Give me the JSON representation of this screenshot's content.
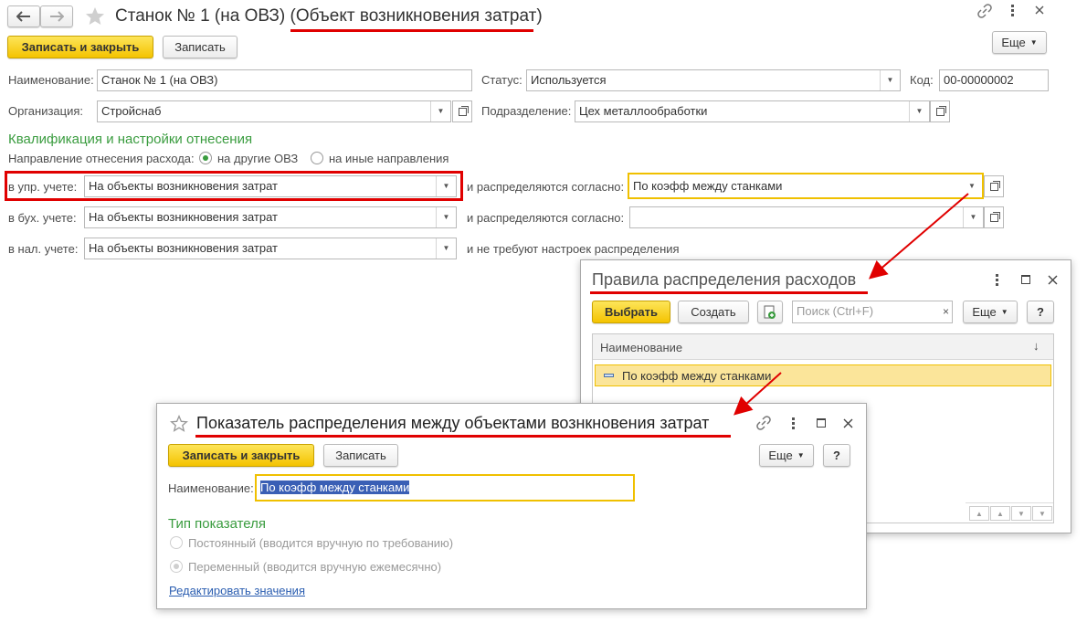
{
  "main": {
    "title": "Станок № 1 (на ОВЗ)",
    "title_suffix": "(Объект возникновения затрат)",
    "save_close": "Записать и закрыть",
    "save": "Записать",
    "more": "Еще",
    "name_label": "Наименование:",
    "name_value": "Станок № 1 (на ОВЗ)",
    "status_label": "Статус:",
    "status_value": "Используется",
    "code_label": "Код:",
    "code_value": "00-00000002",
    "org_label": "Организация:",
    "org_value": "Стройснаб",
    "dept_label": "Подразделение:",
    "dept_value": "Цех металлообработки",
    "section_title": "Квалификация и настройки отнесения",
    "direction_label": "Направление отнесения расхода:",
    "radio_other_ovz": "на другие ОВЗ",
    "radio_other_dirs": "на иные направления",
    "mgmt_label": "в упр. учете:",
    "mgmt_value": "На объекты возникновения затрат",
    "distributed_label": "и распределяются согласно:",
    "mgmt_rule_value": "По коэфф между станками",
    "acc_label": "в бух. учете:",
    "acc_value": "На объекты возникновения затрат",
    "acc_rule_value": "",
    "tax_label": "в нал. учете:",
    "tax_value": "На объекты возникновения затрат",
    "tax_note": "и не требуют настроек распределения"
  },
  "rules_win": {
    "title": "Правила распределения расходов",
    "select": "Выбрать",
    "create": "Создать",
    "search_placeholder": "Поиск (Ctrl+F)",
    "more": "Еще",
    "help": "?",
    "col_name": "Наименование",
    "row1": "По коэфф между станками"
  },
  "indicator_win": {
    "title": "Показатель распределения между объектами вознкновения затрат",
    "save_close": "Записать и закрыть",
    "save": "Записать",
    "more": "Еще",
    "help": "?",
    "name_label": "Наименование:",
    "name_value": "По коэфф между станками",
    "type_title": "Тип показателя",
    "type_const": "Постоянный (вводится вручную по требованию)",
    "type_var": "Переменный (вводится вручную ежемесячно)",
    "edit_link": "Редактировать значения"
  },
  "colors": {
    "accent_yellow": "#f4c300",
    "section_green": "#3a9c3f",
    "highlight_red": "#e00000",
    "focus_border": "#f0c000",
    "selected_row": "#fbe59a",
    "link_blue": "#2a5db0"
  }
}
